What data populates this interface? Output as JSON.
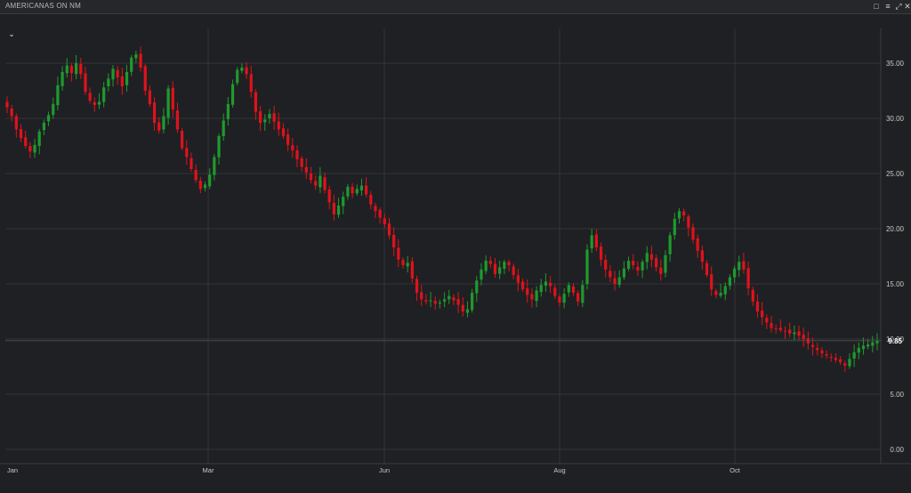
{
  "window": {
    "title": "AMERICANAS ON NM",
    "icons": [
      "restore-icon",
      "settings-icon",
      "expand-icon",
      "close-icon"
    ]
  },
  "colors": {
    "background": "#1f2023",
    "grid": "#34353a",
    "up": "#1e9a2e",
    "down": "#e0121b",
    "axis_text": "#c8c8c8",
    "last_price_label": "#ffffff"
  },
  "chart_data": {
    "type": "candlestick",
    "title": "",
    "xlabel": "",
    "ylabel": "",
    "ylim": [
      0,
      38
    ],
    "y_ticks": [
      "0.00",
      "5.00",
      "10.00",
      "15.00",
      "20.00",
      "25.00",
      "30.00",
      "35.00"
    ],
    "x_ticks": [
      "Jan",
      "Mar",
      "Jun",
      "Aug",
      "Oct"
    ],
    "last_price": "9.85",
    "grid": true,
    "closes": [
      31.0,
      30.2,
      29.0,
      28.2,
      27.5,
      27.0,
      27.6,
      28.8,
      29.6,
      30.3,
      31.3,
      33.0,
      34.2,
      34.8,
      34.1,
      35.0,
      34.0,
      32.4,
      31.6,
      31.2,
      31.5,
      32.8,
      33.6,
      34.5,
      33.7,
      32.9,
      34.2,
      35.5,
      35.8,
      34.6,
      32.5,
      31.3,
      29.6,
      28.9,
      30.2,
      32.7,
      30.8,
      29.0,
      27.3,
      26.5,
      25.4,
      24.4,
      23.6,
      24.0,
      24.9,
      26.5,
      28.4,
      29.8,
      31.3,
      33.1,
      34.4,
      34.6,
      34.0,
      32.4,
      30.6,
      29.6,
      29.9,
      30.4,
      29.7,
      29.0,
      28.4,
      27.6,
      27.1,
      26.3,
      25.6,
      25.1,
      24.4,
      23.9,
      24.8,
      23.5,
      22.4,
      21.3,
      22.1,
      22.9,
      23.8,
      23.2,
      23.6,
      23.9,
      23.1,
      22.2,
      21.6,
      21.0,
      20.4,
      19.4,
      18.3,
      17.2,
      16.7,
      16.9,
      15.5,
      14.2,
      13.6,
      13.4,
      13.5,
      13.2,
      13.3,
      13.6,
      13.9,
      13.5,
      13.1,
      12.5,
      12.7,
      14.2,
      15.3,
      16.3,
      17.1,
      16.8,
      15.9,
      16.5,
      17.0,
      16.7,
      15.8,
      15.1,
      14.5,
      14.0,
      13.6,
      14.4,
      14.9,
      15.2,
      14.8,
      13.9,
      13.3,
      14.1,
      14.9,
      14.2,
      13.4,
      14.9,
      18.1,
      19.4,
      18.3,
      17.2,
      16.3,
      15.6,
      15.0,
      15.6,
      16.4,
      17.1,
      16.7,
      16.2,
      17.0,
      17.8,
      17.2,
      16.5,
      15.9,
      17.6,
      19.4,
      20.9,
      21.6,
      21.2,
      20.1,
      19.0,
      18.0,
      17.0,
      15.8,
      14.5,
      14.0,
      14.2,
      14.8,
      15.6,
      16.4,
      17.0,
      16.3,
      14.6,
      13.4,
      12.5,
      12.0,
      11.5,
      11.0,
      10.9,
      10.8,
      10.7,
      10.5,
      10.6,
      10.3,
      10.0,
      9.6,
      9.3,
      9.0,
      8.7,
      8.5,
      8.3,
      8.1,
      7.9,
      7.6,
      8.2,
      8.8,
      9.2,
      9.4,
      9.5,
      9.7,
      9.85
    ]
  }
}
